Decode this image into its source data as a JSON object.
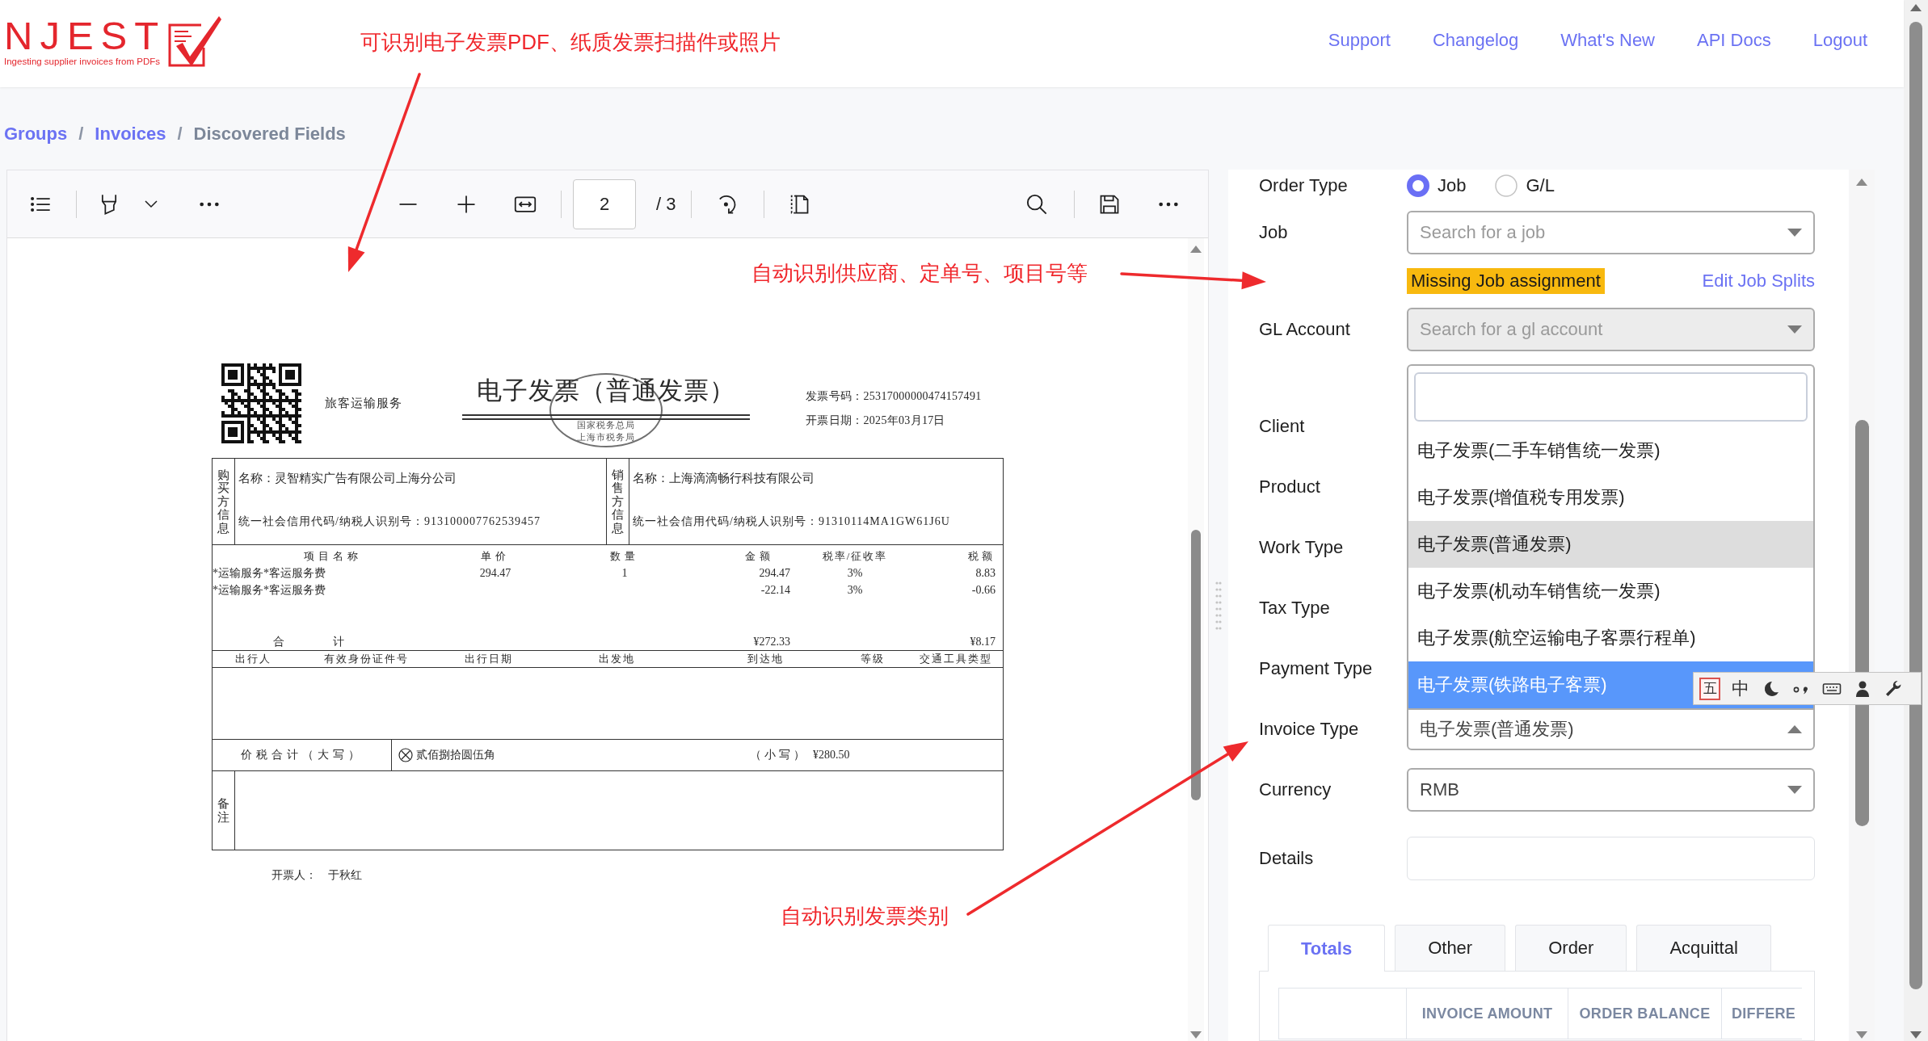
{
  "header": {
    "logo": {
      "wordmark": "NJEST",
      "tagline": "Ingesting supplier invoices from PDFs"
    },
    "nav": [
      "Support",
      "Changelog",
      "What's New",
      "API Docs",
      "Logout"
    ]
  },
  "breadcrumb": {
    "items": [
      {
        "label": "Groups",
        "current": false
      },
      {
        "label": "Invoices",
        "current": false
      },
      {
        "label": "Discovered Fields",
        "current": true
      }
    ],
    "separators": [
      "/",
      "/"
    ]
  },
  "pdf_viewer": {
    "toolbar": {
      "page_number": "2",
      "page_count": "/ 3"
    },
    "invoice": {
      "service_type": "旅客运输服务",
      "title": "电子发票（普通发票）",
      "stamp": {
        "center": "国家税务总局",
        "bottom": "上海市税务局"
      },
      "meta": [
        "发票号码：25317000000474157491",
        "开票日期：2025年03月17日"
      ],
      "parties": [
        {
          "heading": "购买方信息",
          "name": "名称：灵智精实广告有限公司上海分公司",
          "tax_id": "统一社会信用代码/纳税人识别号：913100007762539457"
        },
        {
          "heading": "销售方信息",
          "name": "名称：上海滴滴畅行科技有限公司",
          "tax_id": "统一社会信用代码/纳税人识别号：91310114MA1GW61J6U"
        }
      ],
      "item_columns": [
        "项目名称",
        "单价",
        "数量",
        "金额",
        "税率/征收率",
        "税额"
      ],
      "items": [
        {
          "name": "*运输服务*客运服务费",
          "unit_price": "294.47",
          "quantity": "1",
          "amount": "294.47",
          "tax_rate": "3%",
          "tax": "8.83"
        },
        {
          "name": "*运输服务*客运服务费",
          "amount": "-22.14",
          "tax_rate": "3%",
          "tax": "-0.66"
        }
      ],
      "total": {
        "label": "合 计",
        "amount": "¥272.33",
        "tax": "¥8.17"
      },
      "travel_columns": [
        "出行人",
        "有效身份证件号",
        "出行日期",
        "出发地",
        "到达地",
        "等级",
        "交通工具类型"
      ],
      "grand_total": {
        "label": "价税合计（大写）",
        "amount_in_words": "贰佰捌拾圆伍角",
        "figures_label": "（小写）",
        "amount": "¥280.50"
      },
      "remarks_label": "备注",
      "issuer": {
        "label": "开票人：",
        "name": "于秋红"
      }
    }
  },
  "form": {
    "order_type": {
      "label": "Order Type",
      "options": [
        {
          "label": "Job",
          "selected": true
        },
        {
          "label": "G/L",
          "selected": false
        }
      ]
    },
    "job": {
      "label": "Job",
      "placeholder": "Search for a job",
      "disabled": false
    },
    "job_warning": {
      "text": "Missing Job assignment",
      "link": "Edit Job Splits"
    },
    "gl_account": {
      "label": "GL Account",
      "placeholder": "Search for a gl account",
      "disabled": true
    },
    "covered_fields": [
      "Client",
      "Product",
      "Work Type",
      "Tax Type",
      "Payment Type"
    ],
    "invoice_type": {
      "label": "Invoice Type",
      "value": "电子发票(普通发票)",
      "open": true,
      "options": [
        {
          "label": "电子发票(二手车销售统一发票)",
          "selected": false,
          "highlighted": false
        },
        {
          "label": "电子发票(增值税专用发票)",
          "selected": false,
          "highlighted": false
        },
        {
          "label": "电子发票(普通发票)",
          "selected": true,
          "highlighted": false
        },
        {
          "label": "电子发票(机动车销售统一发票)",
          "selected": false,
          "highlighted": false
        },
        {
          "label": "电子发票(航空运输电子客票行程单)",
          "selected": false,
          "highlighted": false
        },
        {
          "label": "电子发票(铁路电子客票)",
          "selected": false,
          "highlighted": true
        }
      ]
    },
    "currency": {
      "label": "Currency",
      "value": "RMB",
      "open": false
    },
    "details": {
      "label": "Details"
    }
  },
  "tabs": [
    {
      "label": "Totals",
      "selected": true
    },
    {
      "label": "Other",
      "selected": false
    },
    {
      "label": "Order",
      "selected": false
    },
    {
      "label": "Acquittal",
      "selected": false
    }
  ],
  "totals_table": {
    "columns": [
      "INVOICE AMOUNT",
      "ORDER BALANCE",
      "DIFFERE"
    ]
  },
  "ime_toolbar": {
    "input_method": "五",
    "language": "中"
  },
  "annotations": [
    "可识别电子发票PDF、纸质发票扫描件或照片",
    "自动识别供应商、定单号、项目号等",
    "自动识别发票类别"
  ]
}
